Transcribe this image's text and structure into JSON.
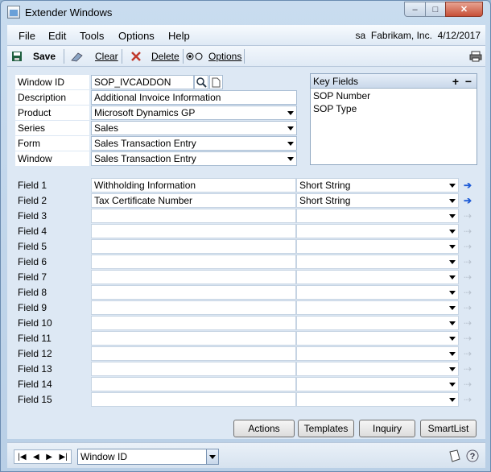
{
  "window": {
    "title": "Extender Windows",
    "buttons": {
      "minimize": "–",
      "maximize": "□",
      "close": "✕"
    }
  },
  "menubar": {
    "items": [
      "File",
      "Edit",
      "Tools",
      "Options",
      "Help"
    ],
    "user": "sa",
    "company": "Fabrikam, Inc.",
    "date": "4/12/2017"
  },
  "toolbar": {
    "save_label": "Save",
    "clear_label": "Clear",
    "delete_label": "Delete",
    "options_label": "Options"
  },
  "form": {
    "window_id_label": "Window ID",
    "window_id_value": "SOP_IVCADDON",
    "description_label": "Description",
    "description_value": "Additional Invoice Information",
    "product_label": "Product",
    "product_value": "Microsoft Dynamics GP",
    "series_label": "Series",
    "series_value": "Sales",
    "form_label": "Form",
    "form_value": "Sales Transaction Entry",
    "window_label": "Window",
    "window_value": "Sales Transaction Entry"
  },
  "key_fields": {
    "header": "Key Fields",
    "items": [
      "SOP Number",
      "SOP Type"
    ]
  },
  "fields": [
    {
      "label": "Field 1",
      "name": "Withholding Information",
      "type": "Short String",
      "active": true
    },
    {
      "label": "Field 2",
      "name": "Tax Certificate Number",
      "type": "Short String",
      "active": true
    },
    {
      "label": "Field 3",
      "name": "",
      "type": "",
      "active": false
    },
    {
      "label": "Field 4",
      "name": "",
      "type": "",
      "active": false
    },
    {
      "label": "Field 5",
      "name": "",
      "type": "",
      "active": false
    },
    {
      "label": "Field 6",
      "name": "",
      "type": "",
      "active": false
    },
    {
      "label": "Field 7",
      "name": "",
      "type": "",
      "active": false
    },
    {
      "label": "Field 8",
      "name": "",
      "type": "",
      "active": false
    },
    {
      "label": "Field 9",
      "name": "",
      "type": "",
      "active": false
    },
    {
      "label": "Field 10",
      "name": "",
      "type": "",
      "active": false
    },
    {
      "label": "Field 11",
      "name": "",
      "type": "",
      "active": false
    },
    {
      "label": "Field 12",
      "name": "",
      "type": "",
      "active": false
    },
    {
      "label": "Field 13",
      "name": "",
      "type": "",
      "active": false
    },
    {
      "label": "Field 14",
      "name": "",
      "type": "",
      "active": false
    },
    {
      "label": "Field 15",
      "name": "",
      "type": "",
      "active": false
    }
  ],
  "actions": {
    "actions_label": "Actions",
    "templates_label": "Templates",
    "inquiry_label": "Inquiry",
    "smartlist_label": "SmartList"
  },
  "statusbar": {
    "sort_by": "Window ID"
  },
  "colors": {
    "accent_arrow": "#1e5bd6",
    "close_button": "#c75038",
    "background": "#dde8f4"
  },
  "icons": [
    "app-icon",
    "save-icon",
    "clear-icon",
    "delete-icon",
    "options-icon",
    "print-icon",
    "lookup-icon",
    "new-note-icon",
    "note-icon",
    "help-icon"
  ]
}
